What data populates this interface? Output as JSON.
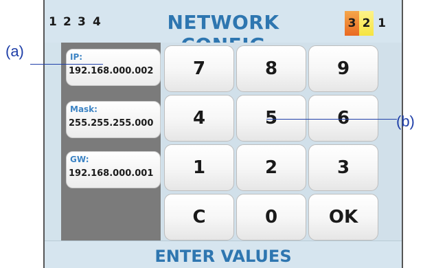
{
  "header": {
    "title": "NETWORK CONFIG",
    "pages": [
      "1",
      "2",
      "3",
      "4"
    ],
    "indicators": [
      "3",
      "2",
      "1"
    ]
  },
  "fields": [
    {
      "label": "IP:",
      "value": "192.168.000.002"
    },
    {
      "label": "Mask:",
      "value": "255.255.255.000"
    },
    {
      "label": "GW:",
      "value": "192.168.000.001"
    }
  ],
  "keypad": {
    "keys": [
      "7",
      "8",
      "9",
      "4",
      "5",
      "6",
      "1",
      "2",
      "3",
      "C",
      "0",
      "OK"
    ]
  },
  "status": "ENTER VALUES",
  "annotations": [
    "(a)",
    "(b)"
  ],
  "colors": {
    "accent": "#2e76b0",
    "panel": "#7b7b7b",
    "indicator_orange": "#ee8030",
    "indicator_yellow": "#f8ea5a"
  }
}
